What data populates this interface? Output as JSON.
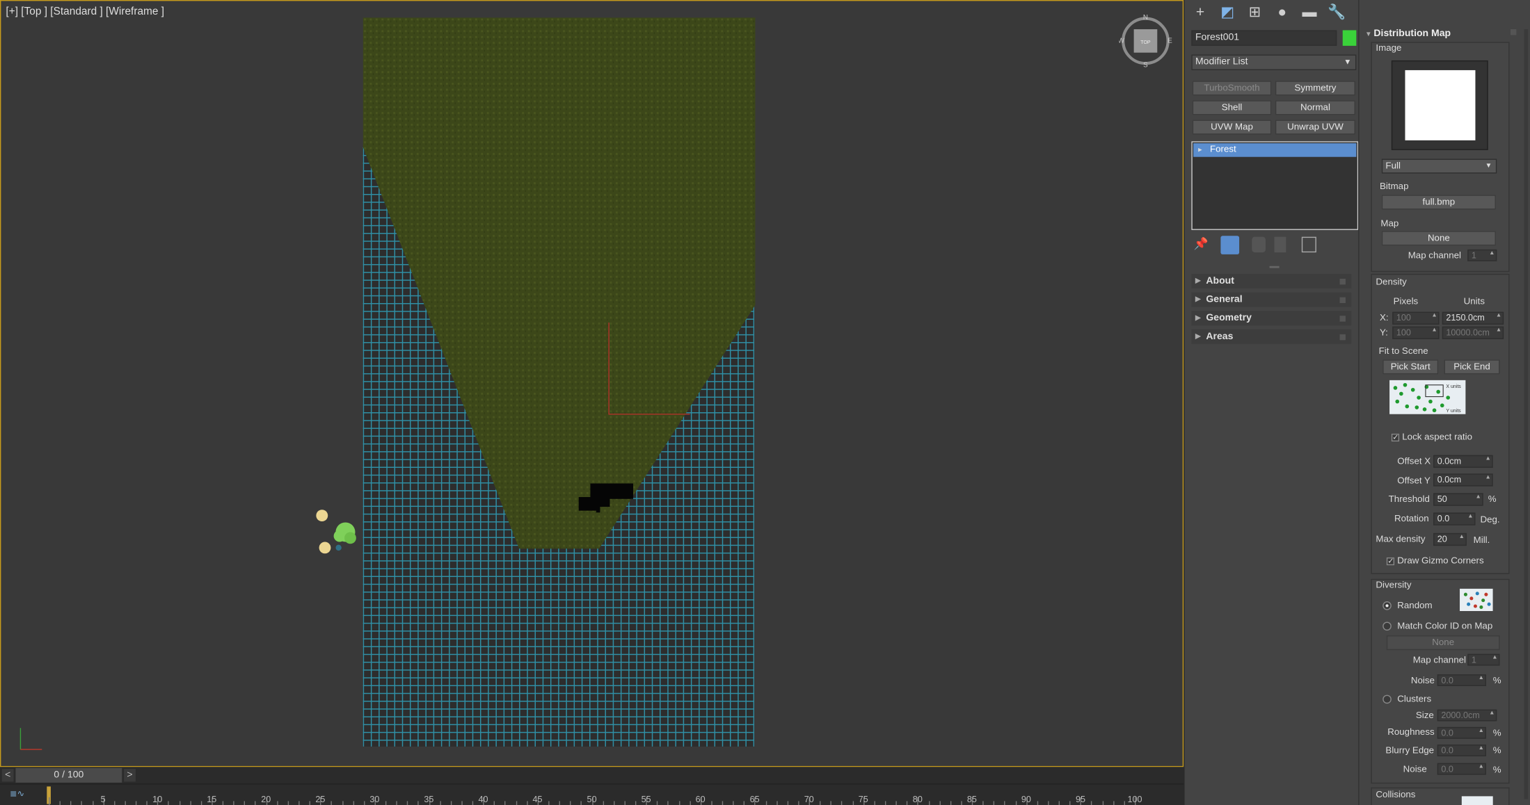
{
  "viewport": {
    "label": "[+] [Top ] [Standard ] [Wireframe ]"
  },
  "viewcube": {
    "n": "N",
    "s": "S",
    "e": "E",
    "w": "W",
    "face": "TOP"
  },
  "timebar": {
    "prev": "<",
    "next": ">",
    "frame": "0 / 100"
  },
  "ruler": {
    "ticks": [
      "5",
      "10",
      "15",
      "20",
      "25",
      "30",
      "35",
      "40",
      "45",
      "50",
      "55",
      "60",
      "65",
      "70",
      "75",
      "80",
      "85",
      "90",
      "95",
      "100"
    ]
  },
  "command_panel": {
    "tab_icons": [
      "create-icon",
      "modify-icon",
      "hierarchy-icon",
      "motion-icon",
      "display-icon",
      "utilities-icon"
    ],
    "tab_glyphs": [
      "+",
      "◩",
      "⊞",
      "●",
      "▬",
      "🔧"
    ],
    "object_name": "Forest001",
    "object_color": "#3ad23a",
    "modifier_list": "Modifier List",
    "modifier_buttons": [
      "TurboSmooth",
      "Symmetry",
      "Shell",
      "Normal",
      "UVW Map",
      "Unwrap UVW"
    ],
    "stack": {
      "selected": "Forest",
      "arrow": "▸"
    },
    "rollouts": [
      "About",
      "General",
      "Geometry",
      "Areas"
    ]
  },
  "distribution": {
    "title": "Distribution Map",
    "image_label": "Image",
    "mode": "Full",
    "bitmap_label": "Bitmap",
    "bitmap_value": "full.bmp",
    "map_label": "Map",
    "map_value": "None",
    "map_channel_label": "Map channel",
    "map_channel_value": "1",
    "density_label": "Density",
    "pixels_label": "Pixels",
    "units_label": "Units",
    "x_label": "X:",
    "y_label": "Y:",
    "x_pixels": "100",
    "y_pixels": "100",
    "x_units": "2150.0cm",
    "y_units": "10000.0cm",
    "fit_label": "Fit to Scene",
    "pick_start": "Pick Start",
    "pick_end": "Pick End",
    "thumb_x_units": "X units",
    "thumb_y_units": "Y units",
    "lock_aspect": "Lock aspect ratio",
    "offset_x_label": "Offset X",
    "offset_x": "0.0cm",
    "offset_y_label": "Offset Y",
    "offset_y": "0.0cm",
    "threshold_label": "Threshold",
    "threshold": "50",
    "threshold_unit": "%",
    "rotation_label": "Rotation",
    "rotation": "0.0",
    "rotation_unit": "Deg.",
    "max_density_label": "Max density",
    "max_density": "20",
    "max_density_unit": "Mill.",
    "draw_gizmo": "Draw Gizmo Corners",
    "check_mark": "✓"
  },
  "diversity": {
    "title": "Diversity",
    "random": "Random",
    "match_color": "Match Color ID on Map",
    "color_map": "None",
    "map_channel_label": "Map channel",
    "map_channel_value": "1",
    "noise_label": "Noise",
    "noise": "0.0",
    "pct": "%",
    "clusters": "Clusters",
    "size_label": "Size",
    "size": "2000.0cm",
    "roughness_label": "Roughness",
    "roughness": "0.0",
    "blurry_label": "Blurry Edge",
    "blurry": "0.0",
    "noise2_label": "Noise",
    "noise2": "0.0"
  },
  "collisions": {
    "title": "Collisions"
  }
}
